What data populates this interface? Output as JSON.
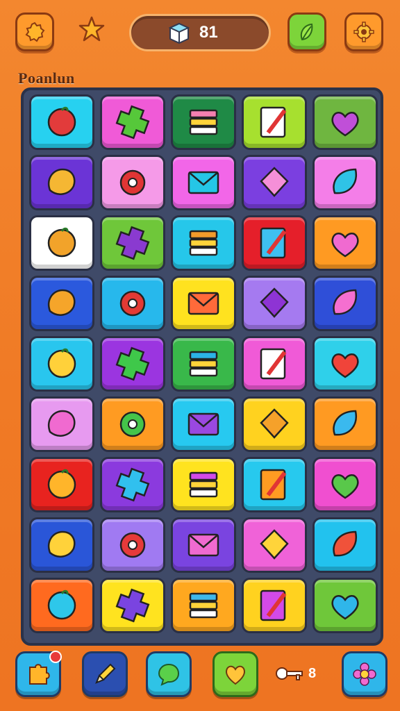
{
  "header": {
    "coin_count": "81"
  },
  "board": {
    "title": "Poanlun",
    "rows": [
      [
        {
          "color": "#27d1f0",
          "icon": "tomato-icon",
          "ic": "#e23b3b"
        },
        {
          "color": "#f05ad7",
          "icon": "green-cross-icon",
          "ic": "#56c83a"
        },
        {
          "color": "#1f8a46",
          "icon": "book-stack-icon",
          "ic": "#f57fb0"
        },
        {
          "color": "#a7e02f",
          "icon": "notepad-pencil-icon",
          "ic": "#ffffff"
        },
        {
          "color": "#6fb640",
          "icon": "heart-pencil-icon",
          "ic": "#c04fd8"
        }
      ],
      [
        {
          "color": "#6b34d6",
          "icon": "leaf-blob-icon",
          "ic": "#f5b733"
        },
        {
          "color": "#f59ae8",
          "icon": "bandage-ball-icon",
          "ic": "#e03535"
        },
        {
          "color": "#f266e8",
          "icon": "envelope-icon",
          "ic": "#25c6e6"
        },
        {
          "color": "#7b3fe0",
          "icon": "pencil-card-icon",
          "ic": "#f58fd8"
        },
        {
          "color": "#f47ee8",
          "icon": "teal-leaf-icon",
          "ic": "#2fc3e6"
        }
      ],
      [
        {
          "color": "#ffffff",
          "icon": "radio-icon",
          "ic": "#f2a32a"
        },
        {
          "color": "#6fc73a",
          "icon": "eggplant-icon",
          "ic": "#8a3ad0"
        },
        {
          "color": "#26c7ea",
          "icon": "speech-bubble-icon",
          "ic": "#f29a2a"
        },
        {
          "color": "#e51f2a",
          "icon": "puzzle-piece-icon",
          "ic": "#3ec0f0"
        },
        {
          "color": "#ff9a22",
          "icon": "leaf-icon",
          "ic": "#f06ad0"
        }
      ],
      [
        {
          "color": "#2b59dd",
          "icon": "chat-eye-icon",
          "ic": "#f5a52a"
        },
        {
          "color": "#27b8ec",
          "icon": "strawberry-icon",
          "ic": "#e33a34"
        },
        {
          "color": "#ffe21f",
          "icon": "brush-icon",
          "ic": "#ff6a3a"
        },
        {
          "color": "#a57af0",
          "icon": "flower-icon",
          "ic": "#8e34d4"
        },
        {
          "color": "#2f4fd8",
          "icon": "tag-pencil-icon",
          "ic": "#f56fd0"
        }
      ],
      [
        {
          "color": "#29c6ee",
          "icon": "mail-icon",
          "ic": "#ffd13a"
        },
        {
          "color": "#9b35e0",
          "icon": "heart-icon",
          "ic": "#3fc84a"
        },
        {
          "color": "#39b84a",
          "icon": "magnifier-ring-icon",
          "ic": "#2bb3e6"
        },
        {
          "color": "#f05ad7",
          "icon": "ring-icon",
          "ic": "#ffffff"
        },
        {
          "color": "#2fd0ea",
          "icon": "swirl-candy-icon",
          "ic": "#f0443a"
        }
      ],
      [
        {
          "color": "#e79af0",
          "icon": "fish-icon",
          "ic": "#f06ad0"
        },
        {
          "color": "#ff9b22",
          "icon": "chat-bubble-icon",
          "ic": "#44c44a"
        },
        {
          "color": "#27c9f0",
          "icon": "link-icon",
          "ic": "#9a48e0"
        },
        {
          "color": "#ffd21f",
          "icon": "chat-fruit-icon",
          "ic": "#f5a12a"
        },
        {
          "color": "#ff9a22",
          "icon": "gear-icon",
          "ic": "#3ab9ee"
        }
      ],
      [
        {
          "color": "#e8231f",
          "icon": "sun-icon",
          "ic": "#ffb52a"
        },
        {
          "color": "#8b3ade",
          "icon": "game-board-icon",
          "ic": "#31c0ee"
        },
        {
          "color": "#ffe31f",
          "icon": "message-icon",
          "ic": "#d34ae8"
        },
        {
          "color": "#27c9ee",
          "icon": "badge-icon",
          "ic": "#ff9b22"
        },
        {
          "color": "#f04fd0",
          "icon": "cookie-icon",
          "ic": "#59c84a"
        }
      ],
      [
        {
          "color": "#2a56d8",
          "icon": "controller-icon",
          "ic": "#ffd23a"
        },
        {
          "color": "#a07af2",
          "icon": "robot-icon",
          "ic": "#e63a3a"
        },
        {
          "color": "#7a44e0",
          "icon": "gamepad-icon",
          "ic": "#f06ad0"
        },
        {
          "color": "#f062d8",
          "icon": "bear-icon",
          "ic": "#ffd43a"
        },
        {
          "color": "#22c2ee",
          "icon": "diamond-icon",
          "ic": "#f0523a"
        }
      ],
      [
        {
          "color": "#ff6a1f",
          "icon": "ice-cream-icon",
          "ic": "#2ec7ea"
        },
        {
          "color": "#ffe31f",
          "icon": "search-icon",
          "ic": "#7a44e0"
        },
        {
          "color": "#ffa81f",
          "icon": "cassette-icon",
          "ic": "#3fb8ea"
        },
        {
          "color": "#ffd21f",
          "icon": "feather-icon",
          "ic": "#d34ae8"
        },
        {
          "color": "#6fc73a",
          "icon": "dropper-icon",
          "ic": "#2fb6ea"
        }
      ]
    ]
  },
  "footer": {
    "key_count": "8"
  }
}
